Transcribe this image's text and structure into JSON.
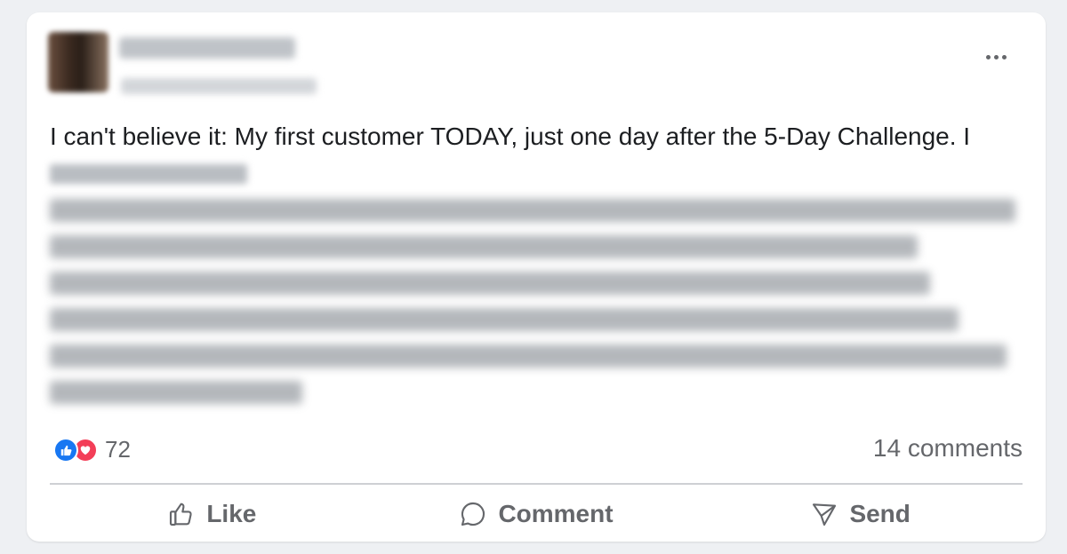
{
  "post": {
    "text": "I can't believe it: My first customer TODAY, just one day after the 5-Day Challenge. I",
    "reaction_count": "72",
    "comments": "14 comments"
  },
  "actions": {
    "like": "Like",
    "comment": "Comment",
    "send": "Send"
  },
  "colors": {
    "like_blue": "#1877f2",
    "love_red": "#f33e58",
    "secondary_text": "#65676b"
  },
  "icons": [
    "more-icon",
    "like-reaction-icon",
    "love-reaction-icon",
    "thumbs-up-icon",
    "comment-icon",
    "send-icon"
  ]
}
